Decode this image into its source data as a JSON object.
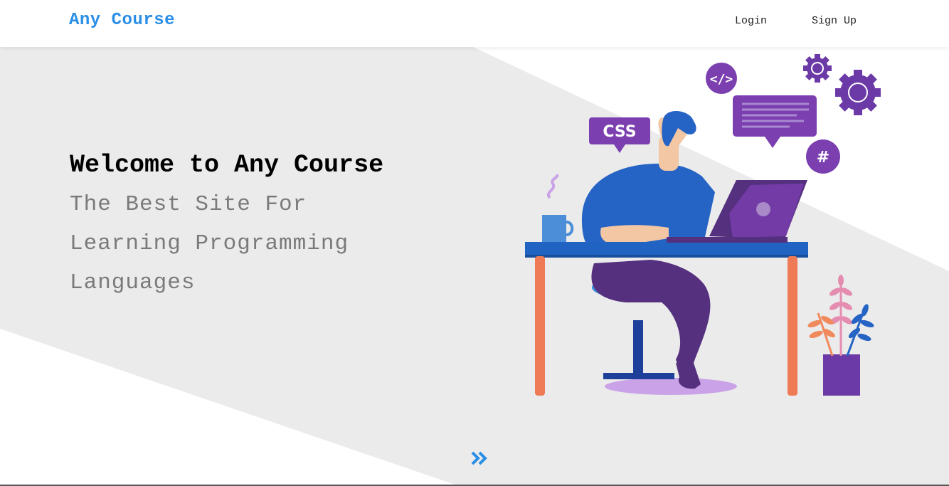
{
  "nav": {
    "brand": "Any Course",
    "login_label": "Login",
    "signup_label": "Sign Up"
  },
  "hero": {
    "title": "Welcome to Any Course",
    "subtitle_lines": [
      "The Best Site For",
      "Learning Programming",
      "Languages"
    ]
  },
  "illustration": {
    "css_badge": "CSS",
    "code_icon_text": "</>",
    "hash_badge": "#"
  },
  "colors": {
    "brand": "#2a8ee6",
    "hero_band": "#ebebeb",
    "purple": "#7b3fb0",
    "blue": "#2563c4"
  },
  "icons": {
    "scroll": "double-chevron-right-icon"
  }
}
